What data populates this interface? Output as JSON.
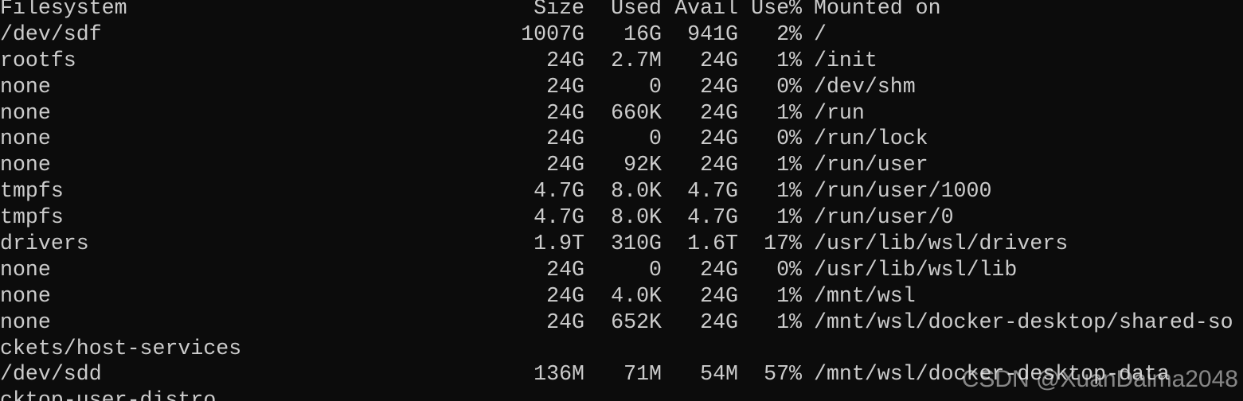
{
  "terminal": {
    "colors": {
      "background": "#0c0c0c",
      "foreground": "#cccccc"
    },
    "header": {
      "filesystem": "Filesystem",
      "size": "Size",
      "used": "Used",
      "avail": "Avail",
      "use": "Use%",
      "mounted_on": "Mounted on"
    },
    "rows": [
      {
        "fs": "/dev/sdf",
        "size": "1007G",
        "used": "16G",
        "avail": "941G",
        "use": "2%",
        "mount": "/"
      },
      {
        "fs": "rootfs",
        "size": "24G",
        "used": "2.7M",
        "avail": "24G",
        "use": "1%",
        "mount": "/init"
      },
      {
        "fs": "none",
        "size": "24G",
        "used": "0",
        "avail": "24G",
        "use": "0%",
        "mount": "/dev/shm"
      },
      {
        "fs": "none",
        "size": "24G",
        "used": "660K",
        "avail": "24G",
        "use": "1%",
        "mount": "/run"
      },
      {
        "fs": "none",
        "size": "24G",
        "used": "0",
        "avail": "24G",
        "use": "0%",
        "mount": "/run/lock"
      },
      {
        "fs": "none",
        "size": "24G",
        "used": "92K",
        "avail": "24G",
        "use": "1%",
        "mount": "/run/user"
      },
      {
        "fs": "tmpfs",
        "size": "4.7G",
        "used": "8.0K",
        "avail": "4.7G",
        "use": "1%",
        "mount": "/run/user/1000"
      },
      {
        "fs": "tmpfs",
        "size": "4.7G",
        "used": "8.0K",
        "avail": "4.7G",
        "use": "1%",
        "mount": "/run/user/0"
      },
      {
        "fs": "drivers",
        "size": "1.9T",
        "used": "310G",
        "avail": "1.6T",
        "use": "17%",
        "mount": "/usr/lib/wsl/drivers"
      },
      {
        "fs": "none",
        "size": "24G",
        "used": "0",
        "avail": "24G",
        "use": "0%",
        "mount": "/usr/lib/wsl/lib"
      },
      {
        "fs": "none",
        "size": "24G",
        "used": "4.0K",
        "avail": "24G",
        "use": "1%",
        "mount": "/mnt/wsl"
      },
      {
        "fs": "none",
        "size": "24G",
        "used": "652K",
        "avail": "24G",
        "use": "1%",
        "mount": "/mnt/wsl/docker-desktop/shared-so"
      }
    ],
    "wrapped_line_1": "ckets/host-services",
    "last_row": {
      "fs": "/dev/sdd",
      "size": "136M",
      "used": "71M",
      "avail": "54M",
      "use": "57%",
      "mount": "/mnt/wsl/docker-desktop-data"
    },
    "wrapped_line_2": "cktop-user-distro",
    "watermark": "CSDN @XuanDaima2048"
  }
}
